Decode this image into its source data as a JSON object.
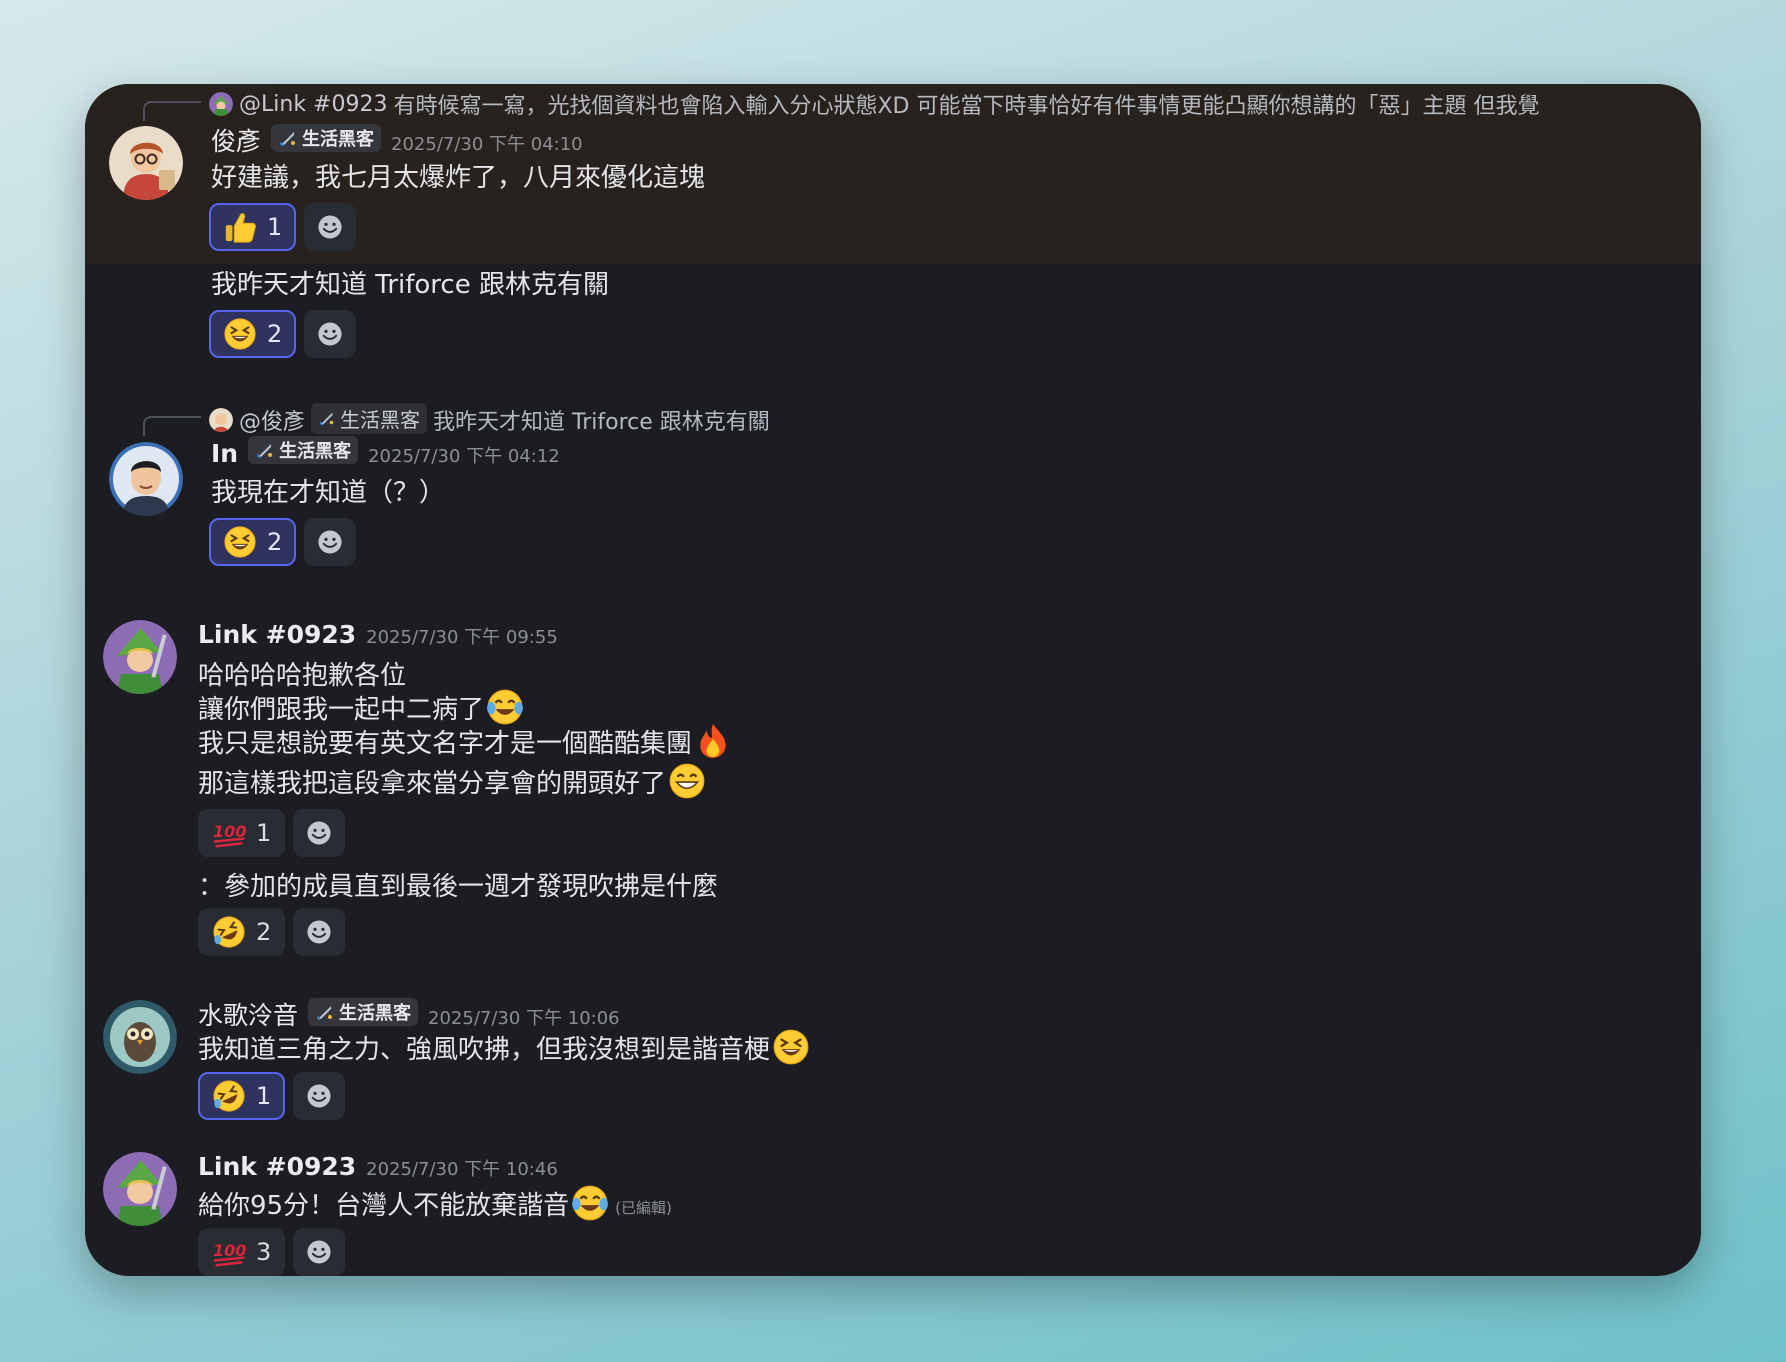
{
  "messages": [
    {
      "reply": {
        "mention": "@Link #0923",
        "text": "有時候寫一寫，光找個資料也會陷入輸入分心狀態XD  可能當下時事恰好有件事情更能凸顯你想講的「惡」主題 但我覺"
      },
      "author": "俊彥",
      "tag": "生活黑客",
      "timestamp": "2025/7/30 下午 04:10",
      "lines": [
        "好建議，我七月太爆炸了，八月來優化這塊"
      ],
      "reactions": [
        {
          "emoji": "thumbs-up",
          "count": "1"
        }
      ]
    },
    {
      "lines": [
        "我昨天才知道 Triforce 跟林克有關"
      ],
      "reactions": [
        {
          "emoji": "laughing-face",
          "count": "2"
        }
      ]
    },
    {
      "reply": {
        "mention": "@俊彥",
        "tag": "生活黑客",
        "text": "我昨天才知道 Triforce 跟林克有關"
      },
      "author": "In",
      "tag": "生活黑客",
      "timestamp": "2025/7/30 下午 04:12",
      "lines": [
        "我現在才知道（？）"
      ],
      "reactions": [
        {
          "emoji": "laughing-face",
          "count": "2"
        }
      ]
    },
    {
      "author": "Link #0923",
      "timestamp": "2025/7/30 下午 09:55",
      "lines": [
        "哈哈哈哈抱歉各位",
        "讓你們跟我一起中二病了",
        "我只是想說要有英文名字才是一個酷酷集團",
        "那這樣我把這段拿來當分享會的開頭好了"
      ],
      "line_emojis": [
        "",
        "tears-of-joy",
        "fire",
        "grin"
      ],
      "reactions": [
        {
          "emoji": "hundred-points",
          "count": "1"
        }
      ]
    },
    {
      "lines": [
        "：參加的成員直到最後一週才發現吹拂是什麼"
      ],
      "reactions": [
        {
          "emoji": "rofl",
          "count": "2"
        }
      ]
    },
    {
      "author": "水歌泠音",
      "tag": "生活黑客",
      "timestamp": "2025/7/30 下午 10:06",
      "lines": [
        "我知道三角之力、強風吹拂，但我沒想到是諧音梗"
      ],
      "line_emojis": [
        "laughing-face"
      ],
      "reactions": [
        {
          "emoji": "rofl",
          "count": "1"
        }
      ]
    },
    {
      "author": "Link #0923",
      "timestamp": "2025/7/30 下午 10:46",
      "lines": [
        "給你95分！台灣人不能放棄諧音"
      ],
      "line_emojis": [
        "tears-of-joy"
      ],
      "edited": "(已編輯)",
      "reactions": [
        {
          "emoji": "hundred-points",
          "count": "3"
        }
      ]
    }
  ],
  "colors": {
    "accent": "#5865f2",
    "background": "#1c1d22",
    "highlight": "#27221d"
  }
}
